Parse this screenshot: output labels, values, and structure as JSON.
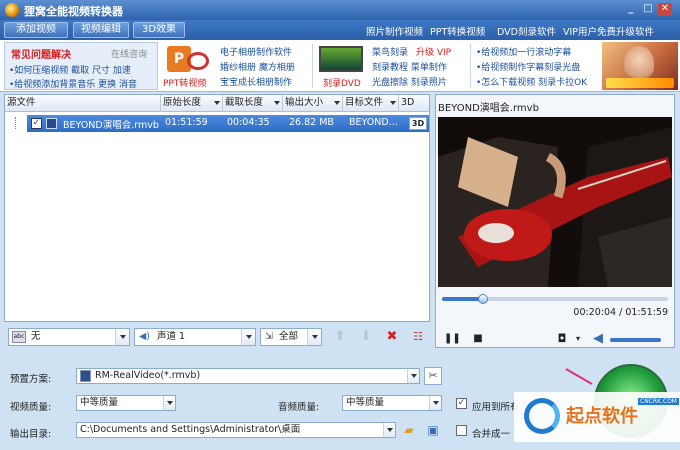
{
  "window": {
    "title": "狸窝全能视频转换器"
  },
  "toolbar": {
    "add_video": "添加视频",
    "edit_video": "视频编辑",
    "effect_3d": "3D效果",
    "links": [
      "照片制作视频",
      "PPT转换视频",
      "DVD刻录软件",
      "VIP用户免费升级软件"
    ]
  },
  "banner": {
    "faq_title": "常见问题解决",
    "faq_online": "在线咨询",
    "faq_line1": "•如何压缩视频  截取  尺寸  加速",
    "faq_line2": "•给视频添加背景音乐  更换  消音",
    "ppt_label": "PPT转视频",
    "col2": [
      "电子相册制作软件",
      "婚纱相册  魔方相册",
      "宝宝成长相册制作"
    ],
    "dvd_label": "刻录DVD",
    "col3_line1a": "菜鸟刻录",
    "col3_line1b": "升级 VIP",
    "col3_line2": "刻录教程  菜单制作",
    "col3_line3": "光盘擦除  刻录照片",
    "col4": [
      "•给视频加一行滚动字幕",
      "•给视频制作字幕刻录光盘",
      "•怎么下载视频  刻录卡拉OK"
    ]
  },
  "file_list": {
    "columns": [
      "源文件",
      "原始长度",
      "截取长度",
      "输出大小",
      "目标文件",
      "3D"
    ],
    "rows": [
      {
        "name": "BEYOND演唱会.rmvb",
        "orig_len": "01:51:59",
        "cut_len": "00:04:35",
        "size": "26.82 MB",
        "target": "BEYOND..."
      }
    ]
  },
  "list_tools": {
    "subtitle": "无",
    "audio": "声道 1",
    "scope": "全部"
  },
  "preview": {
    "filename": "BEYOND演唱会.rmvb",
    "time": "00:20:04 / 01:51:59",
    "progress": 0.18,
    "volume": 0.85
  },
  "settings": {
    "preset_label": "预置方案:",
    "preset_value": "RM-RealVideo(*.rmvb)",
    "video_quality_label": "视频质量:",
    "video_quality_value": "中等质量",
    "audio_quality_label": "音频质量:",
    "audio_quality_value": "中等质量",
    "apply_all": "应用到所有",
    "output_dir_label": "输出目录:",
    "output_dir_value": "C:\\Documents and Settings\\Administrator\\桌面",
    "merge": "合并成一"
  },
  "watermark": {
    "text": "起点软件",
    "url": "CNCRK.COM"
  }
}
